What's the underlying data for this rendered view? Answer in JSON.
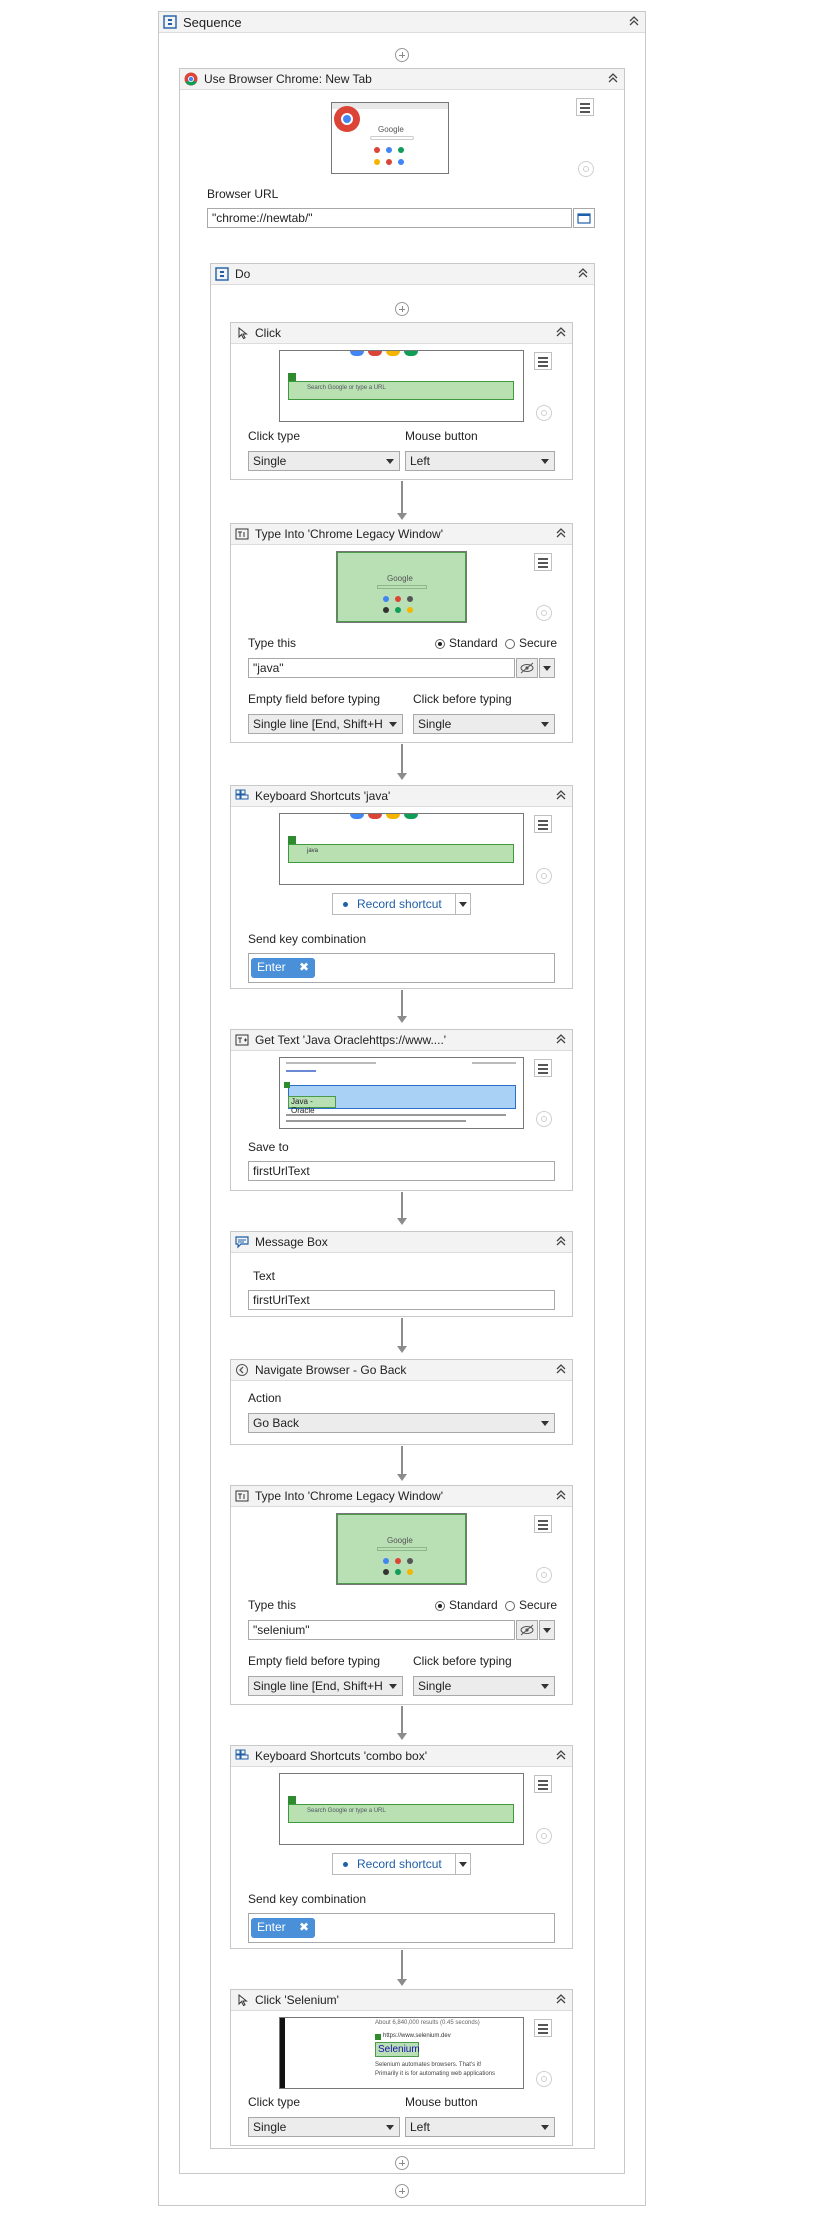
{
  "sequence": {
    "title": "Sequence"
  },
  "browser": {
    "title": "Use Browser Chrome: New Tab",
    "url_label": "Browser URL",
    "url_value": "\"chrome://newtab/\"",
    "thumb_text": "Google"
  },
  "do": {
    "title": "Do"
  },
  "click1": {
    "title": "Click",
    "search_placeholder": "Search Google or type a URL",
    "click_type_label": "Click type",
    "click_type_value": "Single",
    "mouse_button_label": "Mouse button",
    "mouse_button_value": "Left"
  },
  "type1": {
    "title": "Type Into 'Chrome Legacy Window'",
    "thumb_text": "Google",
    "type_this_label": "Type this",
    "radio_standard": "Standard",
    "radio_secure": "Secure",
    "value": "\"java\"",
    "empty_field_label": "Empty field before typing",
    "empty_field_value": "Single line [End, Shift+H",
    "click_before_label": "Click before typing",
    "click_before_value": "Single"
  },
  "keys1": {
    "title": "Keyboard Shortcuts 'java'",
    "search_text": "java",
    "record_label": "Record shortcut",
    "send_key_label": "Send key combination",
    "key_chip": "Enter"
  },
  "gettext": {
    "title": "Get Text 'Java Oraclehttps://www....'",
    "highlight_text": "Java - Oracle",
    "save_to_label": "Save to",
    "save_to_value": "firstUrlText"
  },
  "msgbox": {
    "title": "Message Box",
    "text_label": "Text",
    "text_value": "firstUrlText"
  },
  "navback": {
    "title": "Navigate Browser - Go Back",
    "action_label": "Action",
    "action_value": "Go Back"
  },
  "type2": {
    "title": "Type Into 'Chrome Legacy Window'",
    "thumb_text": "Google",
    "type_this_label": "Type this",
    "radio_standard": "Standard",
    "radio_secure": "Secure",
    "value": "\"selenium\"",
    "empty_field_label": "Empty field before typing",
    "empty_field_value": "Single line [End, Shift+H",
    "click_before_label": "Click before typing",
    "click_before_value": "Single"
  },
  "keys2": {
    "title": "Keyboard Shortcuts 'combo box'",
    "search_placeholder": "Search Google or type a URL",
    "record_label": "Record shortcut",
    "send_key_label": "Send key combination",
    "key_chip": "Enter"
  },
  "click2": {
    "title": "Click 'Selenium'",
    "thumb_results": "About 6,840,000 results (0.45 seconds)",
    "thumb_url": "https://www.selenium.dev",
    "thumb_highlight": "Selenium",
    "thumb_desc1": "Selenium automates browsers. That's it!",
    "thumb_desc2": "Primarily it is for automating web applications",
    "click_type_label": "Click type",
    "click_type_value": "Single",
    "mouse_button_label": "Mouse button",
    "mouse_button_value": "Left"
  },
  "colors": {
    "chip": "#4a90d9",
    "green": "#b8e0b0",
    "accent": "#1f5fa8"
  },
  "icons": [
    "sequence-icon",
    "chrome-icon",
    "do-icon",
    "click-icon",
    "type-into-icon",
    "keyboard-icon",
    "get-text-icon",
    "message-box-icon",
    "navigate-icon",
    "collapse-icon",
    "menu-icon",
    "target-icon",
    "add-icon",
    "eye-off-icon",
    "browser-select-icon",
    "remove-icon",
    "record-dot-icon"
  ]
}
